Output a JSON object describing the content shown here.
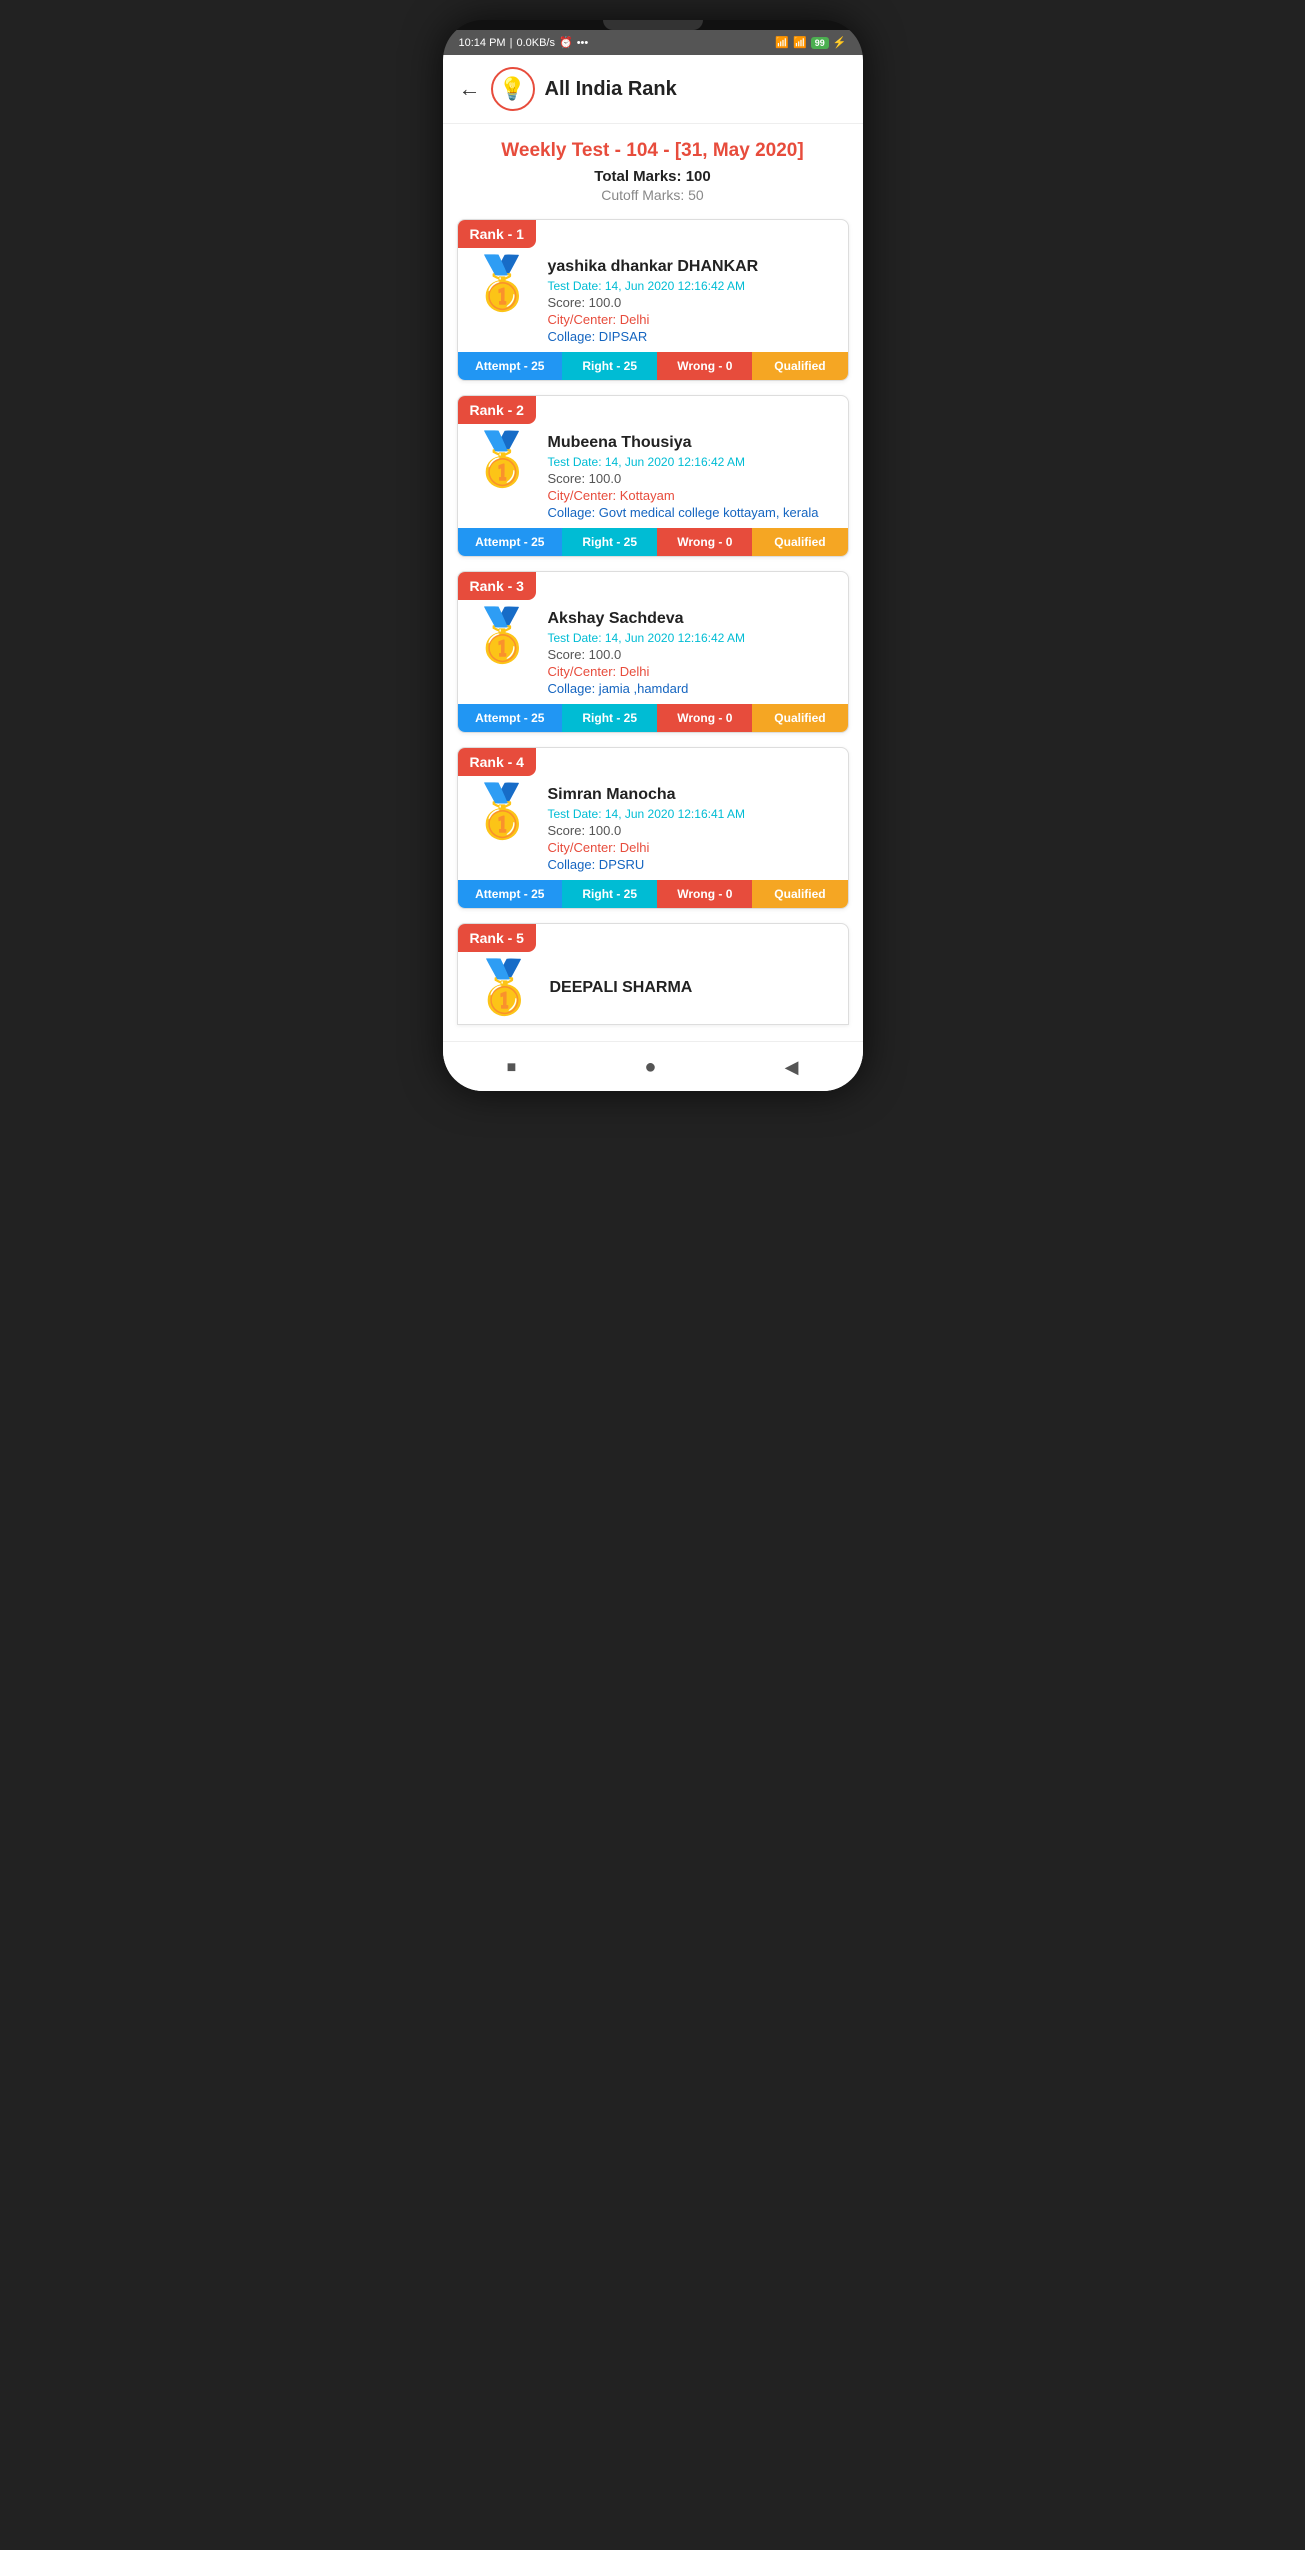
{
  "statusBar": {
    "time": "10:14 PM",
    "network": "0.0KB/s",
    "battery": "99"
  },
  "header": {
    "title": "All India Rank",
    "backLabel": "←"
  },
  "testInfo": {
    "title": "Weekly Test - 104 - [31, May 2020]",
    "totalMarks": "Total Marks: 100",
    "cutoffMarks": "Cutoff Marks: 50"
  },
  "ranks": [
    {
      "rank": "Rank - 1",
      "name": "yashika dhankar DHANKAR",
      "testDate": "Test Date: 14, Jun 2020 12:16:42 AM",
      "score": "Score:  100.0",
      "city": "City/Center: Delhi",
      "collage": "Collage: DIPSAR",
      "attempt": "Attempt - 25",
      "right": "Right - 25",
      "wrong": "Wrong - 0",
      "qualified": "Qualified"
    },
    {
      "rank": "Rank - 2",
      "name": "Mubeena Thousiya",
      "testDate": "Test Date: 14, Jun 2020 12:16:42 AM",
      "score": "Score:  100.0",
      "city": "City/Center: Kottayam",
      "collage": "Collage: Govt medical college kottayam, kerala",
      "attempt": "Attempt - 25",
      "right": "Right - 25",
      "wrong": "Wrong - 0",
      "qualified": "Qualified"
    },
    {
      "rank": "Rank - 3",
      "name": "Akshay Sachdeva",
      "testDate": "Test Date: 14, Jun 2020 12:16:42 AM",
      "score": "Score:  100.0",
      "city": "City/Center: Delhi",
      "collage": "Collage: jamia ,hamdard",
      "attempt": "Attempt - 25",
      "right": "Right - 25",
      "wrong": "Wrong - 0",
      "qualified": "Qualified"
    },
    {
      "rank": "Rank - 4",
      "name": "Simran Manocha",
      "testDate": "Test Date: 14, Jun 2020 12:16:41 AM",
      "score": "Score:  100.0",
      "city": "City/Center: Delhi",
      "collage": "Collage: DPSRU",
      "attempt": "Attempt - 25",
      "right": "Right - 25",
      "wrong": "Wrong - 0",
      "qualified": "Qualified"
    }
  ],
  "rank5": {
    "rank": "Rank - 5",
    "name": "DEEPALI SHARMA"
  },
  "navBar": {
    "squareIcon": "■",
    "circleIcon": "●",
    "triangleIcon": "◀"
  }
}
